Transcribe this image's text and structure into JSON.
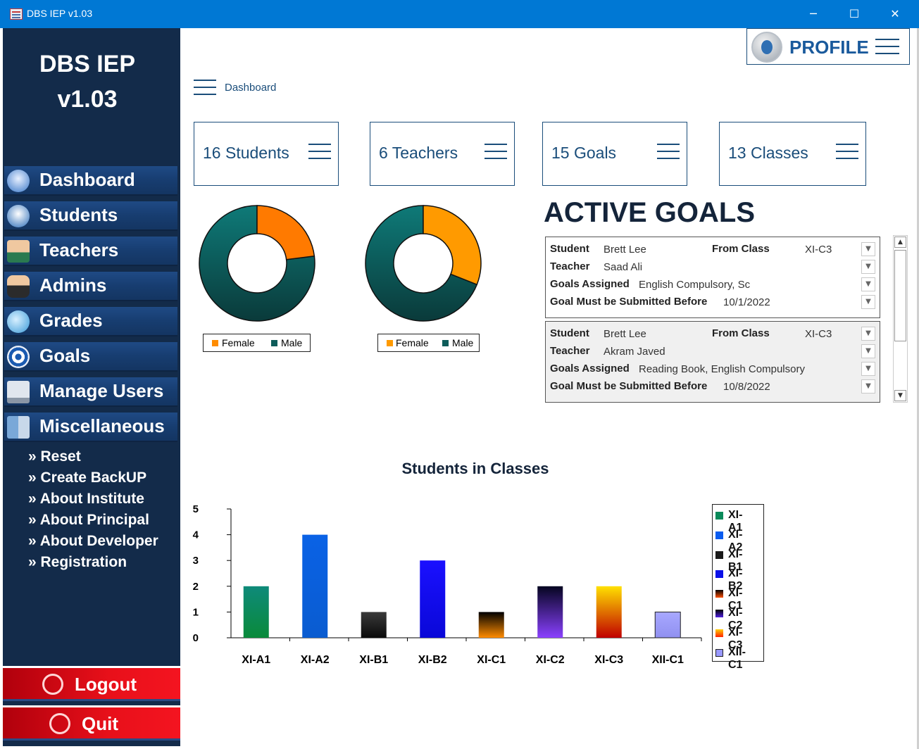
{
  "window": {
    "title": "DBS IEP v1.03",
    "minimize": "─",
    "maximize": "☐",
    "close": "✕"
  },
  "sidebar": {
    "brand_line1": "DBS IEP",
    "brand_line2": "v1.03",
    "nav": [
      {
        "label": "Dashboard",
        "icon": "home-icon"
      },
      {
        "label": "Students",
        "icon": "students-icon"
      },
      {
        "label": "Teachers",
        "icon": "teacher-icon"
      },
      {
        "label": "Admins",
        "icon": "admin-icon"
      },
      {
        "label": "Grades",
        "icon": "grades-icon"
      },
      {
        "label": "Goals",
        "icon": "target-icon"
      },
      {
        "label": "Manage Users",
        "icon": "users-icon"
      },
      {
        "label": "Miscellaneous",
        "icon": "misc-icon"
      }
    ],
    "sub_links": [
      "» Reset",
      "» Create BackUP",
      "» About Institute",
      "» About Principal",
      "» About Developer",
      "» Registration"
    ],
    "logout_label": "Logout",
    "quit_label": "Quit"
  },
  "header": {
    "profile_label": "PROFILE",
    "breadcrumb": "Dashboard"
  },
  "stats": [
    {
      "label": "16 Students"
    },
    {
      "label": "6 Teachers"
    },
    {
      "label": "15 Goals"
    },
    {
      "label": "13 Classes"
    }
  ],
  "colors": {
    "female": "#ff8c00",
    "female_alt": "#ff9a00",
    "male": "#0d5c5a",
    "sidebar": "#132b4a",
    "accent": "#1a4d7a",
    "danger": "#e8101a"
  },
  "donuts": [
    {
      "female_fraction": 0.23,
      "legend_female": "Female",
      "legend_male": "Male"
    },
    {
      "female_fraction": 0.31,
      "legend_female": "Female",
      "legend_male": "Male"
    }
  ],
  "active_goals": {
    "title": "ACTIVE GOALS",
    "labels": {
      "student": "Student",
      "from_class": "From Class",
      "teacher": "Teacher",
      "goals": "Goals Assigned",
      "due": "Goal Must be Submitted Before"
    },
    "items": [
      {
        "student": "Brett Lee",
        "from_class": "XI-C3",
        "teacher": "Saad Ali",
        "goals": "English Compulsory, Sc",
        "due": "10/1/2022"
      },
      {
        "student": "Brett Lee",
        "from_class": "XI-C3",
        "teacher": "Akram Javed",
        "goals": "Reading Book, English Compulsory",
        "due": "10/8/2022"
      }
    ]
  },
  "chart_data": {
    "type": "bar",
    "title": "Students in Classes",
    "categories": [
      "XI-A1",
      "XI-A2",
      "XI-B1",
      "XI-B2",
      "XI-C1",
      "XI-C2",
      "XI-C3",
      "XII-C1"
    ],
    "values": [
      2,
      4,
      1,
      3,
      1,
      2,
      2,
      1
    ],
    "ylim": [
      0,
      5
    ],
    "yticks": [
      "0",
      "1",
      "2",
      "3",
      "4",
      "5"
    ],
    "legend_position": "right",
    "bar_colors": [
      "#0e7a6a",
      "#0a5ce6",
      "#202020",
      "#0a14e0",
      "#3a0a40",
      "#2a0a70",
      "#ff6600",
      "#9999ff"
    ]
  }
}
